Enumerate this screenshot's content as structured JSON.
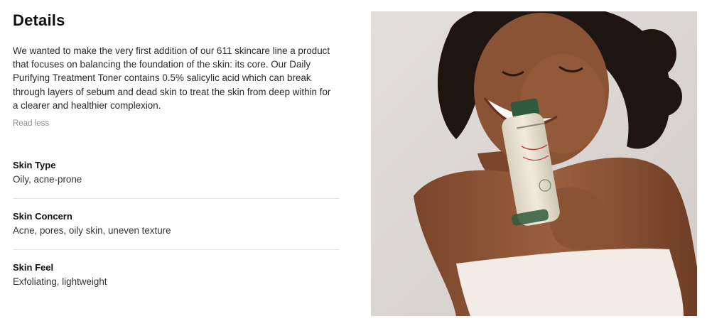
{
  "details": {
    "title": "Details",
    "description": "We wanted to make the very first addition of our 611 skincare line a product that focuses on balancing the foundation of the skin: its core. Our Daily Purifying Treatment Toner contains 0.5% salicylic acid which can break through layers of sebum and dead skin to treat the skin from deep within for a clearer and healthier complexion.",
    "read_less": "Read less"
  },
  "attributes": [
    {
      "label": "Skin Type",
      "value": "Oily, acne-prone"
    },
    {
      "label": "Skin Concern",
      "value": "Acne, pores, oily skin, uneven texture"
    },
    {
      "label": "Skin Feel",
      "value": "Exfoliating, lightweight"
    }
  ],
  "colors": {
    "photo_background": "#dcd8d4",
    "skin": "#8a5336",
    "hair": "#1e1410",
    "top": "#f2ebe6",
    "bottle_body": "#e9e2d2",
    "bottle_cap": "#2f5a3c"
  }
}
